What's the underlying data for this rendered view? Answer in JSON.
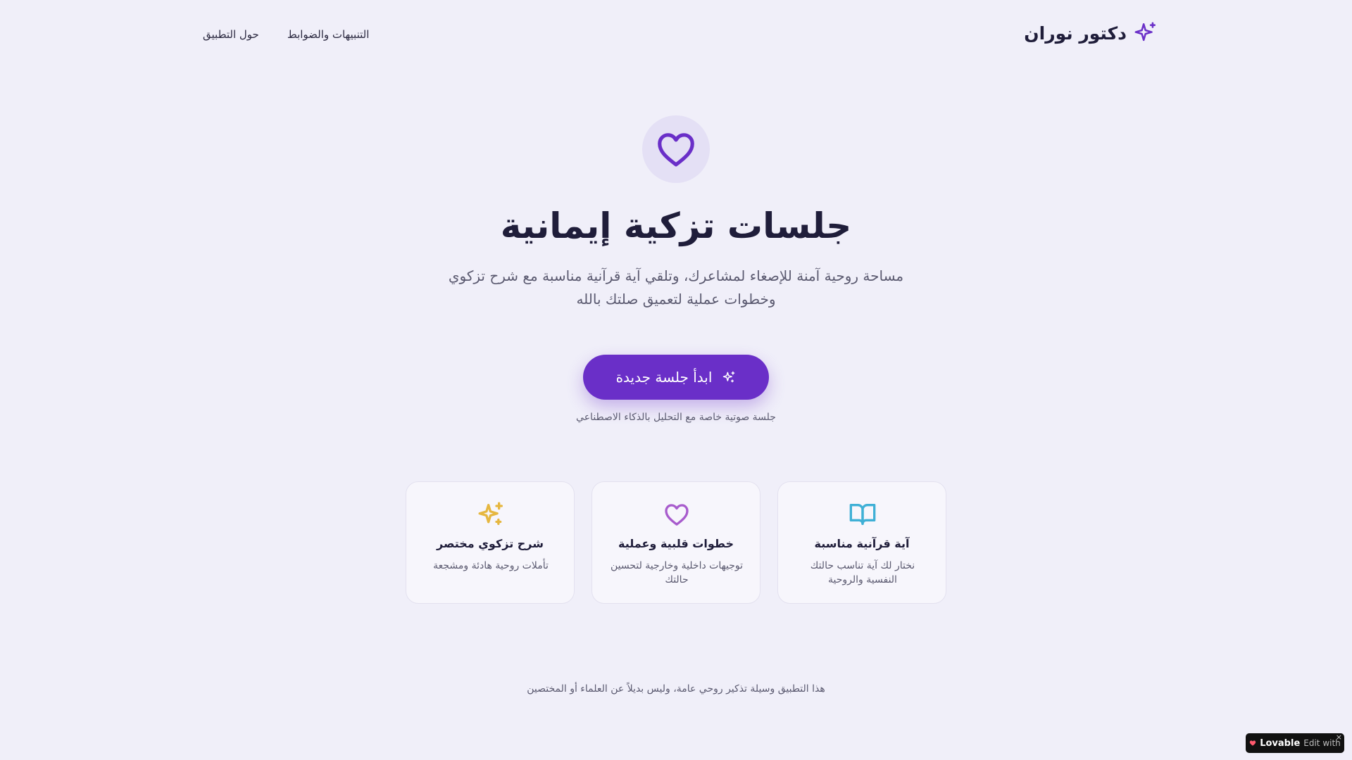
{
  "header": {
    "brand_name": "دكتور نوران",
    "nav": {
      "about": "حول التطبيق",
      "notices": "التنبيهات والضوابط"
    }
  },
  "hero": {
    "title": "جلسات تزكية إيمانية",
    "subtitle": "مساحة روحية آمنة للإصغاء لمشاعرك، وتلقي آية قرآنية مناسبة مع شرح تزكوي وخطوات عملية لتعميق صلتك بالله",
    "cta_label": "ابدأ جلسة جديدة",
    "cta_note": "جلسة صوتية خاصة مع التحليل بالذكاء الاصطناعي"
  },
  "features": [
    {
      "title": "آية قرآنية مناسبة",
      "desc": "نختار لك آية تناسب حالتك النفسية والروحية",
      "icon": "book-icon",
      "color": "#3fb0d6"
    },
    {
      "title": "خطوات قلبية وعملية",
      "desc": "توجيهات داخلية وخارجية لتحسين حالتك",
      "icon": "heart-icon",
      "color": "#a85ccd"
    },
    {
      "title": "شرح تزكوي مختصر",
      "desc": "تأملات روحية هادئة ومشجعة",
      "icon": "sparkles-icon",
      "color": "#e6b740"
    }
  ],
  "footer": {
    "note": "هذا التطبيق وسيلة تذكير روحي عامة، وليس بديلاً عن العلماء أو المختصين"
  },
  "badge": {
    "brand": "Lovable",
    "prefix": "Edit with",
    "close": "×"
  },
  "colors": {
    "accent": "#6a2fc8",
    "background": "#f0eff9",
    "hero_icon_bg": "#e4e0f5"
  }
}
